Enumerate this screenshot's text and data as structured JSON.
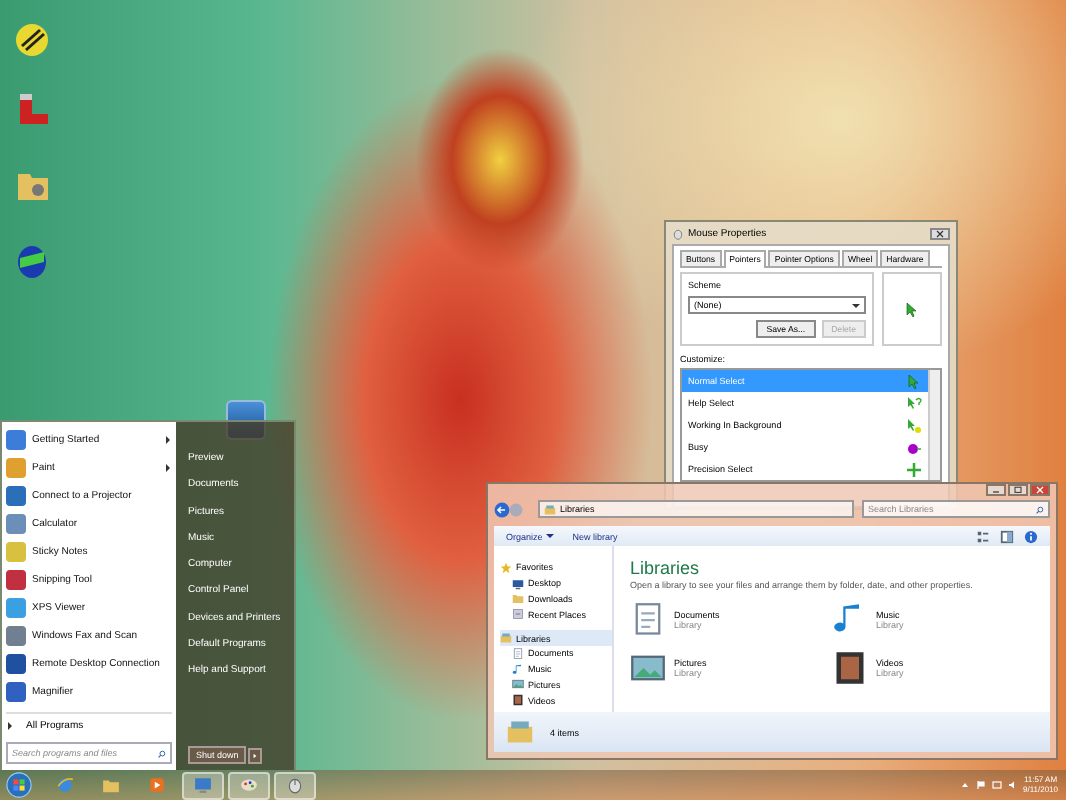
{
  "mouse_properties": {
    "title": "Mouse Properties",
    "tabs": [
      {
        "label": "Buttons",
        "selected": false
      },
      {
        "label": "Pointers",
        "selected": true
      },
      {
        "label": "Pointer Options",
        "selected": false
      },
      {
        "label": "Wheel",
        "selected": false
      },
      {
        "label": "Hardware",
        "selected": false
      }
    ],
    "scheme_label": "Scheme",
    "scheme_value": "(None)",
    "buttons": [
      {
        "label": "Save As...",
        "disabled": false
      },
      {
        "label": "Delete",
        "disabled": true
      }
    ],
    "customize_label": "Customize:",
    "pointers": [
      {
        "label": "Normal Select",
        "kind": "arrow",
        "selected": true
      },
      {
        "label": "Help Select",
        "kind": "help",
        "selected": false
      },
      {
        "label": "Working In Background",
        "kind": "working",
        "selected": false
      },
      {
        "label": "Busy",
        "kind": "busy",
        "selected": false
      },
      {
        "label": "Precision Select",
        "kind": "cross",
        "selected": false
      }
    ]
  },
  "start_menu": {
    "programs": [
      {
        "label": "Getting Started",
        "submenu": true
      },
      {
        "label": "Paint",
        "submenu": true
      },
      {
        "label": "Connect to a Projector",
        "submenu": false
      },
      {
        "label": "Calculator",
        "submenu": false
      },
      {
        "label": "Sticky Notes",
        "submenu": false
      },
      {
        "label": "Snipping Tool",
        "submenu": false
      },
      {
        "label": "XPS Viewer",
        "submenu": false
      },
      {
        "label": "Windows Fax and Scan",
        "submenu": false
      },
      {
        "label": "Remote Desktop Connection",
        "submenu": false
      },
      {
        "label": "Magnifier",
        "submenu": false
      }
    ],
    "all_programs": "All Programs",
    "search": {
      "placeholder": "Search programs and files"
    },
    "places": [
      "Preview",
      "Documents",
      "Pictures",
      "Music",
      "Computer",
      "Control Panel",
      "Devices and Printers",
      "Default Programs",
      "Help and Support"
    ],
    "shutdown": "Shut down"
  },
  "explorer": {
    "address": "Libraries",
    "search": {
      "placeholder": "Search Libraries"
    },
    "toolbar": [
      "Organize",
      "New library"
    ],
    "nav": [
      {
        "label": "Favorites",
        "kind": "star",
        "selected": false,
        "children": [
          {
            "label": "Desktop",
            "kind": "desktop",
            "selected": false
          },
          {
            "label": "Downloads",
            "kind": "folder",
            "selected": false
          },
          {
            "label": "Recent Places",
            "kind": "recent",
            "selected": false
          }
        ]
      },
      {
        "label": "Libraries",
        "kind": "library",
        "selected": true,
        "children": [
          {
            "label": "Documents",
            "kind": "doc",
            "selected": false
          },
          {
            "label": "Music",
            "kind": "music",
            "selected": false
          },
          {
            "label": "Pictures",
            "kind": "picture",
            "selected": false
          },
          {
            "label": "Videos",
            "kind": "video",
            "selected": false
          }
        ]
      }
    ],
    "heading": "Libraries",
    "subtitle": "Open a library to see your files and arrange them by folder, date, and other properties.",
    "libraries": [
      {
        "name": "Documents",
        "type": "Library",
        "kind": "doc"
      },
      {
        "name": "Music",
        "type": "Library",
        "kind": "music"
      },
      {
        "name": "Pictures",
        "type": "Library",
        "kind": "picture"
      },
      {
        "name": "Videos",
        "type": "Library",
        "kind": "video"
      }
    ],
    "status": "4 items"
  },
  "taskbar": {
    "apps": [
      {
        "kind": "browser",
        "active": false
      },
      {
        "kind": "folder",
        "active": false
      },
      {
        "kind": "media",
        "active": false
      },
      {
        "kind": "remote",
        "active": true
      },
      {
        "kind": "paint",
        "active": true
      },
      {
        "kind": "mouse",
        "active": true
      }
    ],
    "clock": {
      "time": "11:57 AM",
      "date": "9/11/2010"
    }
  }
}
